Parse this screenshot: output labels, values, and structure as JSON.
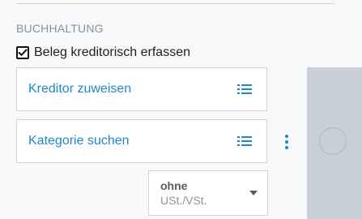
{
  "section": {
    "title": "BUCHHALTUNG"
  },
  "checkbox": {
    "label": "Beleg kreditorisch erfassen",
    "checked": true
  },
  "creditor_field": {
    "label": "Kreditor zuweisen",
    "icon": "list-icon"
  },
  "category_field": {
    "label": "Kategorie suchen",
    "icon": "list-icon"
  },
  "more_menu": {
    "icon": "more-vertical-icon"
  },
  "tax_select": {
    "line1": "ohne",
    "line2": "USt./VSt.",
    "icon": "chevron-down-icon"
  },
  "colors": {
    "accent": "#1e88c7",
    "panel": "#c8cfd8"
  }
}
